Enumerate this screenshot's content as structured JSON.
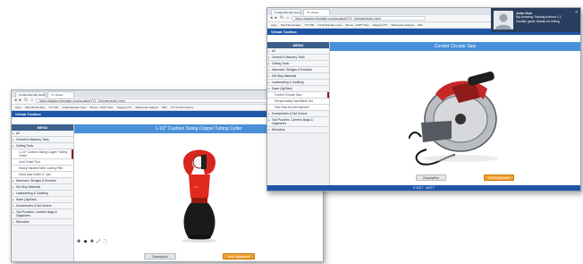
{
  "back_window": {
    "tabs": [
      {
        "label": "Curated Bundle Viewer - Job"
      },
      {
        "label": "VT Viewer"
      }
    ],
    "url": "https://staging.thevtsite.com/curated/VT1_0/viewer/index.html",
    "bookmarks": [
      "Apps",
      "Plant Bookmarks",
      "VTT DB",
      "Install Bundles Issue",
      "Bouse - SUPT Plan",
      "Staging VTT",
      "Wikimedia Analysis",
      "Wiki",
      "VTT Product Demo"
    ],
    "app_title": "Virtual Toolbox",
    "sidebar_header": "MENU",
    "sidebar_items": [
      {
        "label": "All",
        "sub": false,
        "active": false
      },
      {
        "label": "Cement & Masonry Tools",
        "sub": false,
        "active": false
      },
      {
        "label": "Cutting Tools",
        "sub": false,
        "active": false
      },
      {
        "label": "1-1/2\" Cushion Swing Copper Tubing Cutter",
        "sub": true,
        "active": true
      },
      {
        "label": "Cold Chisel Tool",
        "sub": true,
        "active": false
      },
      {
        "label": "Heavy Handled Wire Cutting Plier",
        "sub": true,
        "active": false
      },
      {
        "label": "Hand Saw Cutter 6\" Jaw",
        "sub": true,
        "active": false
      },
      {
        "label": "Hammers, Sledges & Punches",
        "sub": false,
        "active": false
      },
      {
        "label": "Hot Stop Materials",
        "sub": false,
        "active": false
      },
      {
        "label": "Leadworking & Caulking",
        "sub": false,
        "active": false
      },
      {
        "label": "Saws (Jig/Saw)",
        "sub": false,
        "active": false
      },
      {
        "label": "Screwdrivers & Nut Drivers",
        "sub": false,
        "active": false
      },
      {
        "label": "Tool Pouches, Carriers, Bags & Organizers",
        "sub": false,
        "active": false
      },
      {
        "label": "Wrenches",
        "sub": false,
        "active": false
      }
    ],
    "page_title": "1-1/2\" Cushion Swing Copper Tubing Cutter",
    "btn_description": "Description",
    "btn_add": "Add Equipment",
    "controls": "✚ ◆ ✚ ⤢ ⛶"
  },
  "front_window": {
    "tabs": [
      {
        "label": "Curated Bundle Viewer - Job"
      },
      {
        "label": "VT Viewer"
      }
    ],
    "url": "https://staging.thevtsite.com/curated/VT1_0/viewer/index.html",
    "bookmarks": [
      "Apps",
      "Plant Bookmarks",
      "VTT DB",
      "Install Bundles Issue",
      "Bouse - SUPT Plan",
      "Staging VTT",
      "Wikimedia Analysis",
      "Wiki"
    ],
    "app_title": "Virtual Toolbox",
    "sidebar_header": "MENU",
    "sidebar_items": [
      {
        "label": "All",
        "sub": false,
        "active": false
      },
      {
        "label": "Cement & Masonry Tools",
        "sub": false,
        "active": false
      },
      {
        "label": "Cutting Tools",
        "sub": false,
        "active": false
      },
      {
        "label": "Hammers, Sledges & Punches",
        "sub": false,
        "active": false
      },
      {
        "label": "Hot Stop Materials",
        "sub": false,
        "active": false
      },
      {
        "label": "Leadworking & Caulking",
        "sub": false,
        "active": false
      },
      {
        "label": "Saws (Jig/Saw)",
        "sub": false,
        "active": false
      },
      {
        "label": "Corded Circular Saw",
        "sub": true,
        "active": true
      },
      {
        "label": "Reciprocating Saw Blade Set",
        "sub": true,
        "active": false
      },
      {
        "label": "Hole Saw Kit with Mandrel",
        "sub": true,
        "active": false
      },
      {
        "label": "Screwdrivers & Nut Drivers",
        "sub": false,
        "active": false
      },
      {
        "label": "Tool Pouches, Carriers, Bags & Organizers",
        "sub": false,
        "active": false
      },
      {
        "label": "Wrenches",
        "sub": false,
        "active": false
      }
    ],
    "page_title": "Corded Circular Saw",
    "btn_description": "Description",
    "btn_add": "Add Equipment",
    "footer": "© 2017 · MSTT",
    "profile": {
      "name": "John Doe",
      "line1": "My Amazing Training Advisor 1.1",
      "line2": "Cordial, great, thanks for letting"
    }
  }
}
